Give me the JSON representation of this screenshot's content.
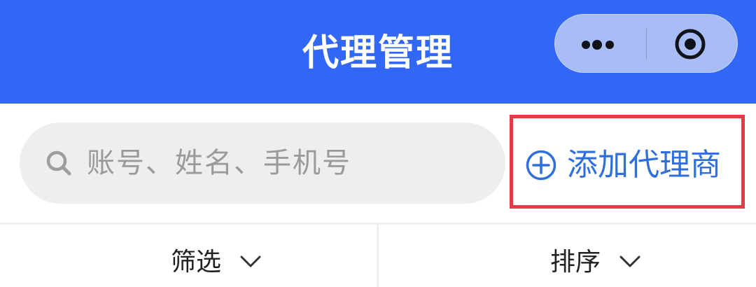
{
  "header": {
    "title": "代理管理",
    "background": "#3267f6",
    "capsule": {
      "more_icon": "more-dots-icon",
      "close_icon": "target-circle-icon"
    }
  },
  "search": {
    "placeholder": "账号、姓名、手机号",
    "icon": "search-icon"
  },
  "actions": {
    "add_agent_label": "添加代理商",
    "add_agent_icon": "plus-circle-icon",
    "accent": "#2f6fdc",
    "highlight_color": "#e23c48"
  },
  "toolbar": {
    "filter_label": "筛选",
    "sort_label": "排序",
    "chevron_icon": "chevron-down-icon"
  }
}
